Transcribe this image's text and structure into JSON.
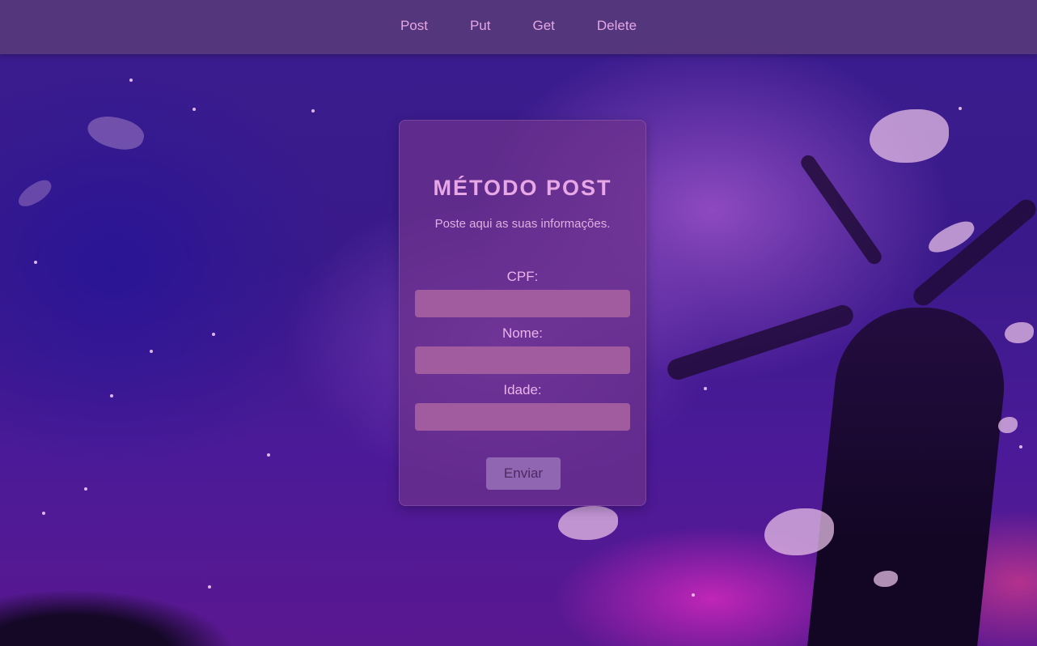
{
  "nav": {
    "items": [
      {
        "label": "Post"
      },
      {
        "label": "Put"
      },
      {
        "label": "Get"
      },
      {
        "label": "Delete"
      }
    ]
  },
  "form": {
    "title": "MÉTODO POST",
    "subtitle": "Poste aqui as suas informações.",
    "fields": [
      {
        "label": "CPF:",
        "value": ""
      },
      {
        "label": "Nome:",
        "value": ""
      },
      {
        "label": "Idade:",
        "value": ""
      }
    ],
    "submit_label": "Enviar"
  },
  "colors": {
    "accent_text": "#e8a8e6",
    "input_background": "#a15c9f",
    "button_background": "#9066b2",
    "navbar_background": "#5a3c78"
  }
}
